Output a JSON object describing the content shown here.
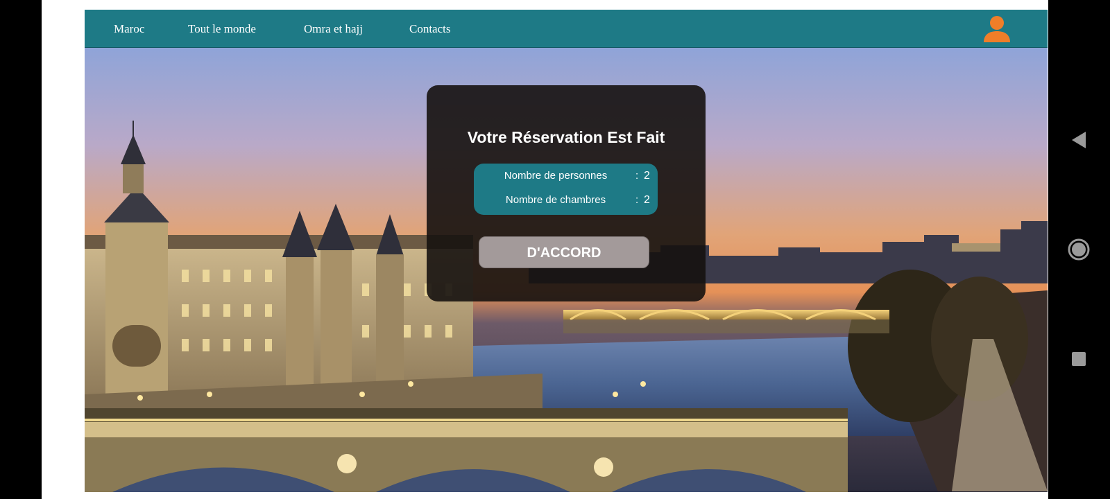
{
  "navbar": {
    "items": [
      {
        "label": "Maroc"
      },
      {
        "label": "Tout le monde"
      },
      {
        "label": "Omra et hajj"
      },
      {
        "label": "Contacts"
      }
    ],
    "user_icon": "user-icon",
    "background_color": "#1e7a86",
    "icon_color": "#f07e29"
  },
  "hero": {
    "image": "Paris Seine at dusk (Conciergerie, bridges)"
  },
  "modal": {
    "title": "Votre Réservation Est Fait",
    "rows": [
      {
        "label": "Nombre de personnes",
        "separator": ":",
        "value": "2"
      },
      {
        "label": "Nombre de chambres",
        "separator": ":",
        "value": "2"
      }
    ],
    "ok_label": "D'ACCORD",
    "summary_color": "#1e7a86",
    "button_color": "#a39a9a"
  },
  "android_nav": {
    "back_icon": "back-triangle-icon",
    "home_icon": "home-circle-icon",
    "recents_icon": "recents-square-icon"
  }
}
